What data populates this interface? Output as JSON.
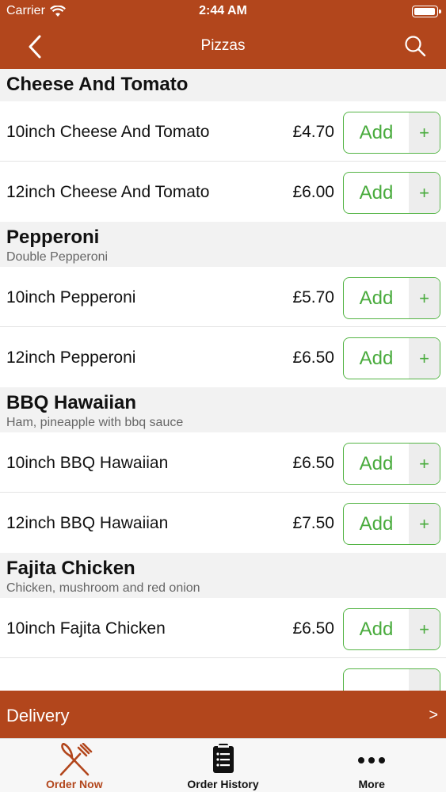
{
  "status_bar": {
    "carrier": "Carrier",
    "time": "2:44 AM",
    "wifi_icon": "wifi-icon",
    "battery_icon": "battery-icon"
  },
  "nav": {
    "title": "Pizzas",
    "back_icon": "chevron-left-icon",
    "search_icon": "search-icon"
  },
  "colors": {
    "brand": "#b2461c",
    "accent_green": "#49ab3d"
  },
  "sections": [
    {
      "name": "Cheese And Tomato",
      "description": "",
      "items": [
        {
          "name": "10inch Cheese And Tomato",
          "price": "£4.70",
          "add_label": "Add",
          "plus_label": "+"
        },
        {
          "name": "12inch Cheese And Tomato",
          "price": "£6.00",
          "add_label": "Add",
          "plus_label": "+"
        }
      ]
    },
    {
      "name": "Pepperoni",
      "description": "Double Pepperoni",
      "items": [
        {
          "name": "10inch Pepperoni",
          "price": "£5.70",
          "add_label": "Add",
          "plus_label": "+"
        },
        {
          "name": "12inch Pepperoni",
          "price": "£6.50",
          "add_label": "Add",
          "plus_label": "+"
        }
      ]
    },
    {
      "name": "BBQ Hawaiian",
      "description": "Ham, pineapple with bbq sauce",
      "items": [
        {
          "name": "10inch BBQ Hawaiian",
          "price": "£6.50",
          "add_label": "Add",
          "plus_label": "+"
        },
        {
          "name": "12inch BBQ Hawaiian",
          "price": "£7.50",
          "add_label": "Add",
          "plus_label": "+"
        }
      ]
    },
    {
      "name": "Fajita Chicken",
      "description": "Chicken, mushroom and red onion",
      "items": [
        {
          "name": "10inch Fajita Chicken",
          "price": "£6.50",
          "add_label": "Add",
          "plus_label": "+"
        },
        {
          "name": "",
          "price": "",
          "add_label": "",
          "plus_label": ""
        }
      ]
    }
  ],
  "delivery": {
    "label": "Delivery",
    "chevron": ">"
  },
  "tabbar": {
    "items": [
      {
        "label": "Order Now",
        "icon": "fork-knife-icon",
        "active": true,
        "color": "#b2461c"
      },
      {
        "label": "Order History",
        "icon": "clipboard-list-icon",
        "active": false,
        "color": "#111111"
      },
      {
        "label": "More",
        "icon": "more-dots-icon",
        "active": false,
        "color": "#111111"
      }
    ]
  }
}
